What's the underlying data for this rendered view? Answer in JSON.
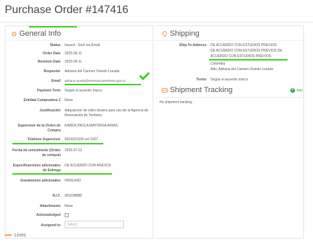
{
  "page": {
    "title": "Purchase Order #147416"
  },
  "general": {
    "title": "General Info",
    "fields": [
      {
        "label": "Status",
        "value": "Issued - Sent via Email"
      },
      {
        "label": "Order Date",
        "value": "2025-06-11"
      },
      {
        "label": "Revision Date",
        "value": "2025-06-11"
      },
      {
        "label": "Requester",
        "value": "Adriana del Carmen Oviedo Lozada"
      },
      {
        "label": "Email",
        "value": "adriana.oviedo@renovacionterritorio.gov.co"
      },
      {
        "label": "Payment Term",
        "value": "Según el acuerdo marco"
      },
      {
        "label": "Entidad Compradora 2",
        "value": "None"
      },
      {
        "label": "Justificación",
        "value": "Adquisición de video beams para uso de la Agencia de Renovación de Territorio"
      },
      {
        "label": "Supervisor de la Orden de Compra",
        "value": "KAREN PAOLA MAYORGA ARIAS"
      },
      {
        "label": "Telefono Supervisor",
        "value": "6014221030 ext 1667"
      },
      {
        "label": "Fecha de vencimiento (Orden de compra)",
        "value": "2025-07-01"
      },
      {
        "label": "Especificaciones adicionales de Entrega",
        "value": "DE ACUERDO CON ANEXOS"
      },
      {
        "label": "Gravámenes adicionales",
        "value": "NINGUNO"
      },
      {
        "label": "N.I.T.",
        "value": "901038888"
      },
      {
        "label": "Attachments",
        "value": "None"
      },
      {
        "label": "Acknowledged",
        "value": ""
      },
      {
        "label": "Assigned to",
        "value": ""
      }
    ],
    "assigned_placeholder": "Select"
  },
  "shipping": {
    "title": "Shipping",
    "ship_to_label": "Ship-To Address",
    "ship_to_lines": [
      "DE ACUERDO CON ESTUDIOS PREVIOS",
      "DE ACUERDO CON ESTUDIOS PREVIOS DE",
      "ACUERDO CON ESTUDIOS PREVIOS",
      "Colombia",
      "Attn: Adriana del Carmen Oviedo Lozada"
    ],
    "terms_label": "Terms",
    "terms_value": "Según el acuerdo marco"
  },
  "tracking": {
    "title": "Shipment Tracking",
    "add_label": "Add",
    "empty_text": "No shipment tracking."
  },
  "bottom": {
    "tab_label": "Lines"
  },
  "colors": {
    "highlight": "#3cd021",
    "icon_orange": "#f0a050",
    "add_green": "#3aa84e"
  }
}
